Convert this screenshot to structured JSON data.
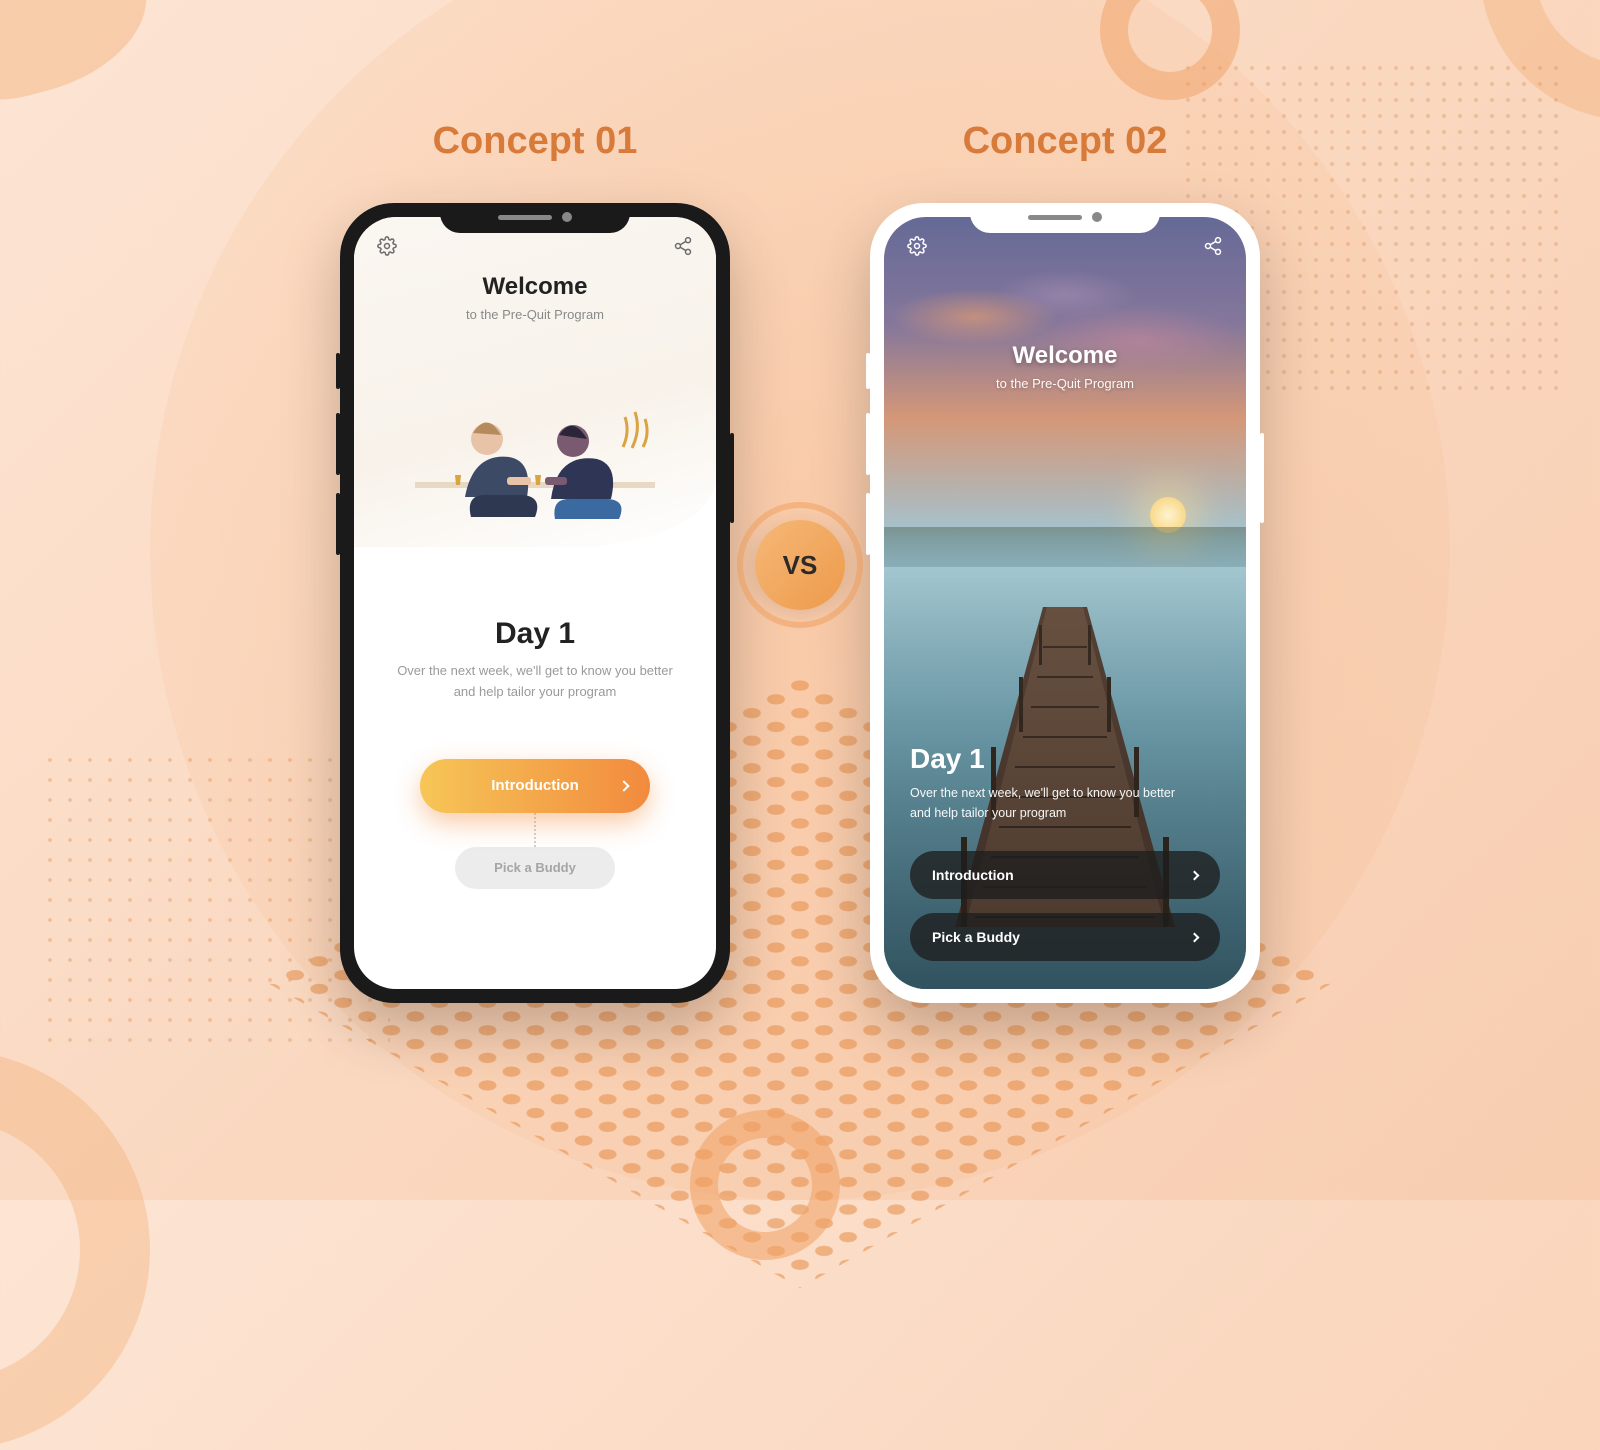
{
  "concepts": {
    "left_title": "Concept 01",
    "right_title": "Concept 02",
    "vs_label": "VS"
  },
  "c1": {
    "welcome": "Welcome",
    "subtitle": "to the Pre-Quit Program",
    "day_title": "Day 1",
    "description": "Over the next week, we'll get to know you better and help tailor your program",
    "primary_btn": "Introduction",
    "secondary_btn": "Pick a Buddy",
    "icons": {
      "settings": "settings",
      "share": "share"
    }
  },
  "c2": {
    "welcome": "Welcome",
    "subtitle": "to the Pre-Quit Program",
    "day_title": "Day 1",
    "description": "Over the next week, we'll get to know you better and help tailor your program",
    "buttons": [
      "Introduction",
      "Pick a Buddy"
    ],
    "icons": {
      "settings": "settings",
      "share": "share"
    }
  },
  "colors": {
    "accent_orange": "#ee9a4a",
    "title_orange": "#d87b3a",
    "btn_grad_start": "#f6c657",
    "btn_grad_end": "#f28a3e"
  }
}
